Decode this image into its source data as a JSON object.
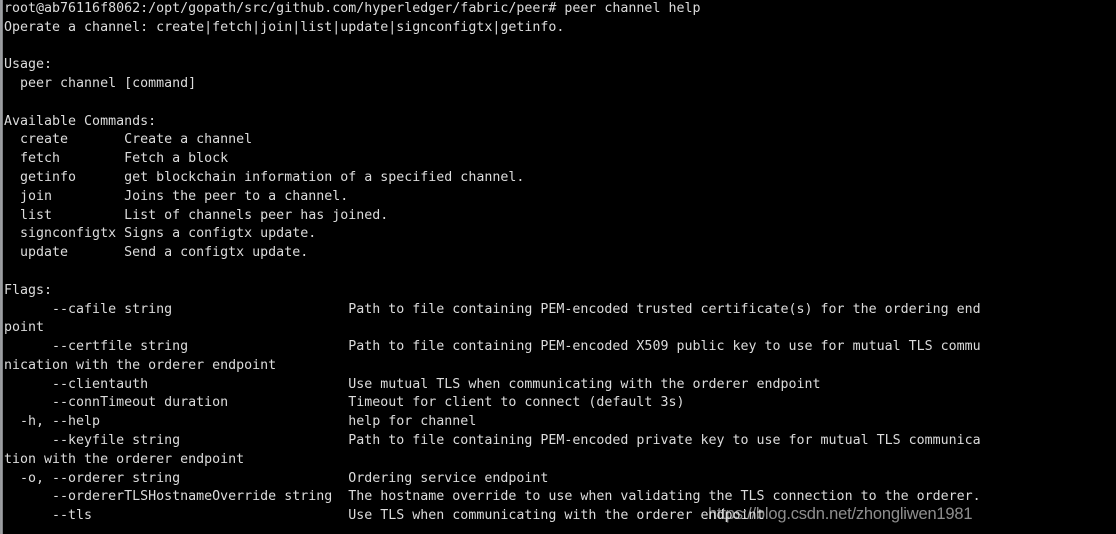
{
  "terminal": {
    "background_color": "#000000",
    "foreground_color": "#dcdcdc",
    "prompt": {
      "user": "root",
      "host": "ab76116f8062",
      "cwd": "/opt/gopath/src/github.com/hyperledger/fabric/peer",
      "symbol": "#",
      "full": "root@ab76116f8062:/opt/gopath/src/github.com/hyperledger/fabric/peer#"
    },
    "command_entered": "peer channel help",
    "prompt_line": "root@ab76116f8062:/opt/gopath/src/github.com/hyperledger/fabric/peer# peer channel help",
    "output": {
      "summary": "Operate a channel: create|fetch|join|list|update|signconfigtx|getinfo.",
      "usage_heading": "Usage:",
      "usage_line": "  peer channel [command]",
      "commands_heading": "Available Commands:",
      "commands": [
        {
          "name": "create",
          "description": "Create a channel"
        },
        {
          "name": "fetch",
          "description": "Fetch a block"
        },
        {
          "name": "getinfo",
          "description": "get blockchain information of a specified channel."
        },
        {
          "name": "join",
          "description": "Joins the peer to a channel."
        },
        {
          "name": "list",
          "description": "List of channels peer has joined."
        },
        {
          "name": "signconfigtx",
          "description": "Signs a configtx update."
        },
        {
          "name": "update",
          "description": "Send a configtx update."
        }
      ],
      "flags_heading": "Flags:",
      "flags": [
        {
          "short": "",
          "long": "--cafile",
          "argtype": "string",
          "description": "Path to file containing PEM-encoded trusted certificate(s) for the ordering endpoint"
        },
        {
          "short": "",
          "long": "--certfile",
          "argtype": "string",
          "description": "Path to file containing PEM-encoded X509 public key to use for mutual TLS communication with the orderer endpoint"
        },
        {
          "short": "",
          "long": "--clientauth",
          "argtype": "",
          "description": "Use mutual TLS when communicating with the orderer endpoint"
        },
        {
          "short": "",
          "long": "--connTimeout",
          "argtype": "duration",
          "description": "Timeout for client to connect (default 3s)"
        },
        {
          "short": "-h",
          "long": "--help",
          "argtype": "",
          "description": "help for channel"
        },
        {
          "short": "",
          "long": "--keyfile",
          "argtype": "string",
          "description": "Path to file containing PEM-encoded private key to use for mutual TLS communication with the orderer endpoint"
        },
        {
          "short": "-o",
          "long": "--orderer",
          "argtype": "string",
          "description": "Ordering service endpoint"
        },
        {
          "short": "",
          "long": "--ordererTLSHostnameOverride",
          "argtype": "string",
          "description": "The hostname override to use when validating the TLS connection to the orderer."
        },
        {
          "short": "",
          "long": "--tls",
          "argtype": "",
          "description": "Use TLS when communicating with the orderer endpoint"
        }
      ]
    },
    "rendered_lines": [
      "root@ab76116f8062:/opt/gopath/src/github.com/hyperledger/fabric/peer# peer channel help",
      "Operate a channel: create|fetch|join|list|update|signconfigtx|getinfo.",
      "",
      "Usage:",
      "  peer channel [command]",
      "",
      "Available Commands:",
      "  create       Create a channel",
      "  fetch        Fetch a block",
      "  getinfo      get blockchain information of a specified channel.",
      "  join         Joins the peer to a channel.",
      "  list         List of channels peer has joined.",
      "  signconfigtx Signs a configtx update.",
      "  update       Send a configtx update.",
      "",
      "Flags:",
      "      --cafile string                      Path to file containing PEM-encoded trusted certificate(s) for the ordering end",
      "point",
      "      --certfile string                    Path to file containing PEM-encoded X509 public key to use for mutual TLS commu",
      "nication with the orderer endpoint",
      "      --clientauth                         Use mutual TLS when communicating with the orderer endpoint",
      "      --connTimeout duration               Timeout for client to connect (default 3s)",
      "  -h, --help                               help for channel",
      "      --keyfile string                     Path to file containing PEM-encoded private key to use for mutual TLS communica",
      "tion with the orderer endpoint",
      "  -o, --orderer string                     Ordering service endpoint",
      "      --ordererTLSHostnameOverride string  The hostname override to use when validating the TLS connection to the orderer.",
      "      --tls                                Use TLS when communicating with the orderer endpoint"
    ]
  },
  "watermark": {
    "text": "https://blog.csdn.net/zhongliwen1981",
    "color": "#e4e4e4"
  }
}
